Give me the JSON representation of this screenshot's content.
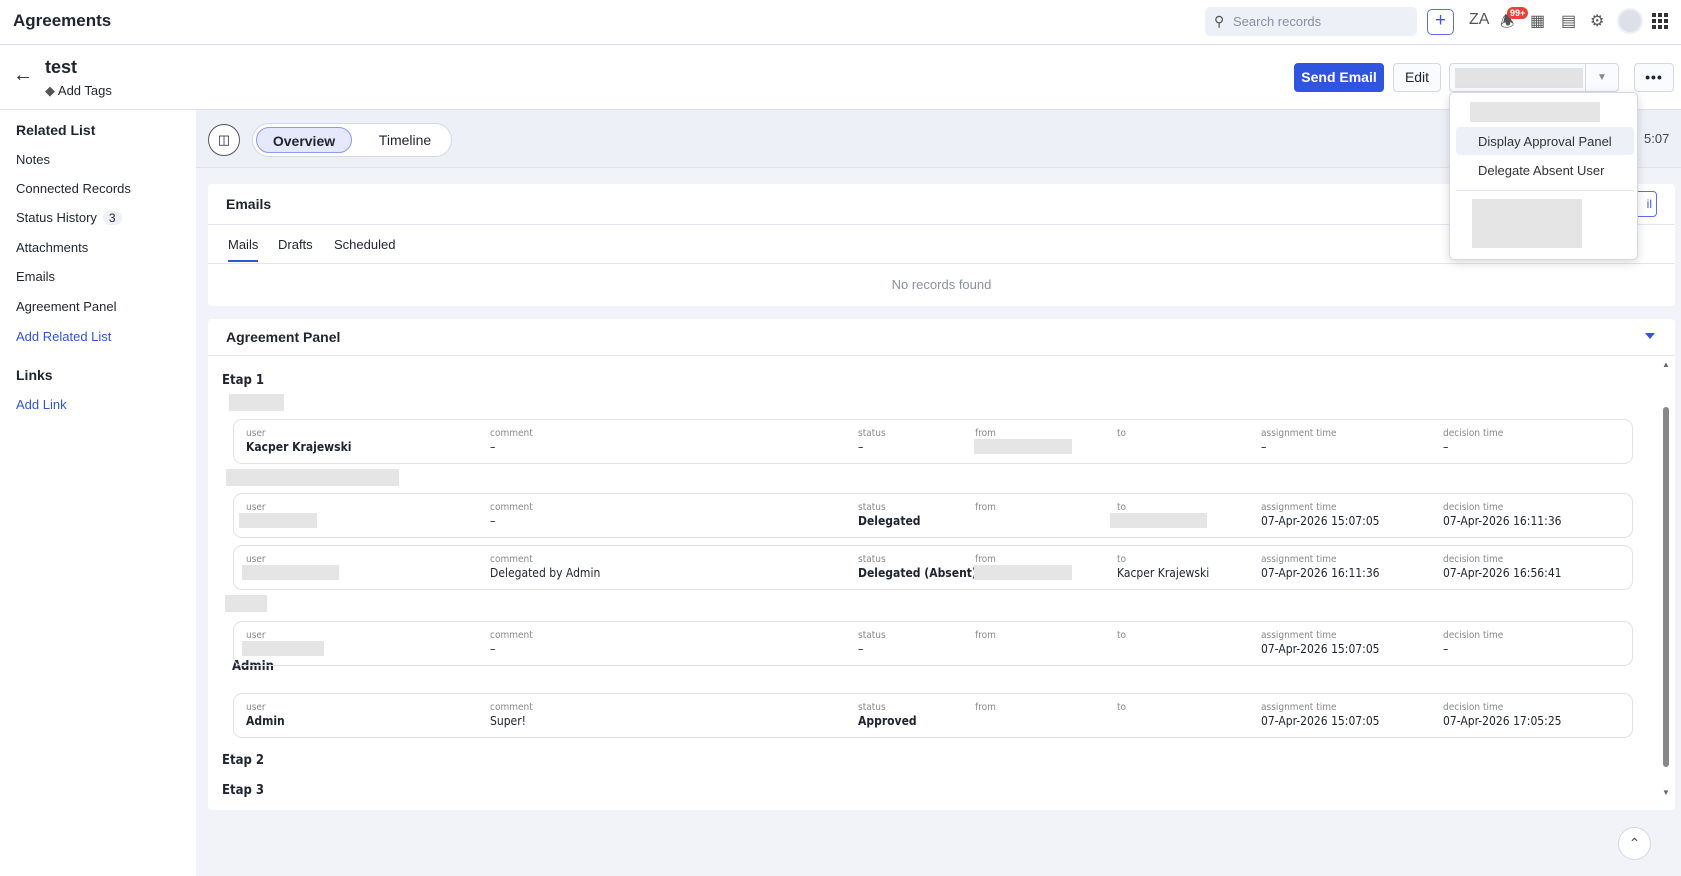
{
  "app": {
    "title": "Agreements"
  },
  "topbar": {
    "search_placeholder": "Search records",
    "plus": "+",
    "notif_badge": "99+",
    "icons": [
      "search-icon",
      "plus-icon",
      "translate-icon",
      "bell-icon",
      "calendar-icon",
      "marketplace-icon",
      "gear-icon",
      "avatar",
      "apps-grid-icon"
    ]
  },
  "record": {
    "title": "test",
    "add_tags": "Add Tags"
  },
  "actions": {
    "send_email": "Send Email",
    "edit": "Edit",
    "more": "•••"
  },
  "dropdown": {
    "items": [
      "Display Approval Panel",
      "Delegate Absent User"
    ]
  },
  "sidebar": {
    "related_list": "Related List",
    "items": [
      "Notes",
      "Connected Records",
      "Status History",
      "Attachments",
      "Emails",
      "Agreement Panel"
    ],
    "status_history_count": "3",
    "add_related": "Add Related List",
    "links": "Links",
    "add_link": "Add Link"
  },
  "view": {
    "tabs": [
      "Overview",
      "Timeline"
    ],
    "time_fragment": "5:07"
  },
  "emails": {
    "title": "Emails",
    "tabs": [
      "Mails",
      "Drafts",
      "Scheduled"
    ],
    "empty": "No records found",
    "button_fragment": "il"
  },
  "panel": {
    "title": "Agreement Panel",
    "labels": {
      "user": "user",
      "comment": "comment",
      "status": "status",
      "from": "from",
      "to": "to",
      "assignment": "assignment time",
      "decision": "decision time"
    },
    "etaps": [
      "Etap 1",
      "Etap 2",
      "Etap 3"
    ],
    "group_admin": "Admin",
    "rows": [
      {
        "user": "Kacper Krajewski",
        "comment": "–",
        "status": "–",
        "from": "",
        "to": "",
        "assignment": "–",
        "decision": "–"
      },
      {
        "user": "",
        "comment": "–",
        "status": "Delegated",
        "from": "",
        "to": "",
        "assignment": "07-Apr-2026 15:07:05",
        "decision": "07-Apr-2026 16:11:36"
      },
      {
        "user": "",
        "comment": "Delegated by Admin",
        "status": "Delegated (Absent)",
        "from": "",
        "to": "Kacper Krajewski",
        "assignment": "07-Apr-2026 16:11:36",
        "decision": "07-Apr-2026 16:56:41"
      },
      {
        "user": "",
        "comment": "–",
        "status": "–",
        "from": "",
        "to": "",
        "assignment": "07-Apr-2026 15:07:05",
        "decision": "–"
      },
      {
        "user": "Admin",
        "comment": "Super!",
        "status": "Approved",
        "from": "",
        "to": "",
        "assignment": "07-Apr-2026 15:07:05",
        "decision": "07-Apr-2026 17:05:25"
      }
    ]
  }
}
